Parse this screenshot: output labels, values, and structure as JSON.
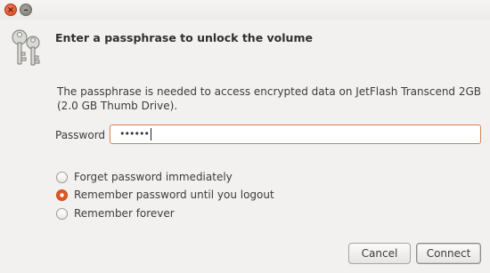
{
  "window": {
    "close_icon": "×",
    "minimize_icon": "–"
  },
  "dialog": {
    "heading": "Enter a passphrase to unlock the volume",
    "description": "The passphrase is needed to access encrypted data on JetFlash Transcend 2GB (2.0 GB Thumb Drive).",
    "password_label": "Password",
    "password_value": "••••••",
    "options": [
      {
        "label": "Forget password immediately",
        "selected": false
      },
      {
        "label": "Remember password until you logout",
        "selected": true
      },
      {
        "label": "Remember forever",
        "selected": false
      }
    ],
    "cancel_label": "Cancel",
    "connect_label": "Connect"
  },
  "colors": {
    "accent": "#e0561f",
    "field_border": "#d7824e"
  }
}
